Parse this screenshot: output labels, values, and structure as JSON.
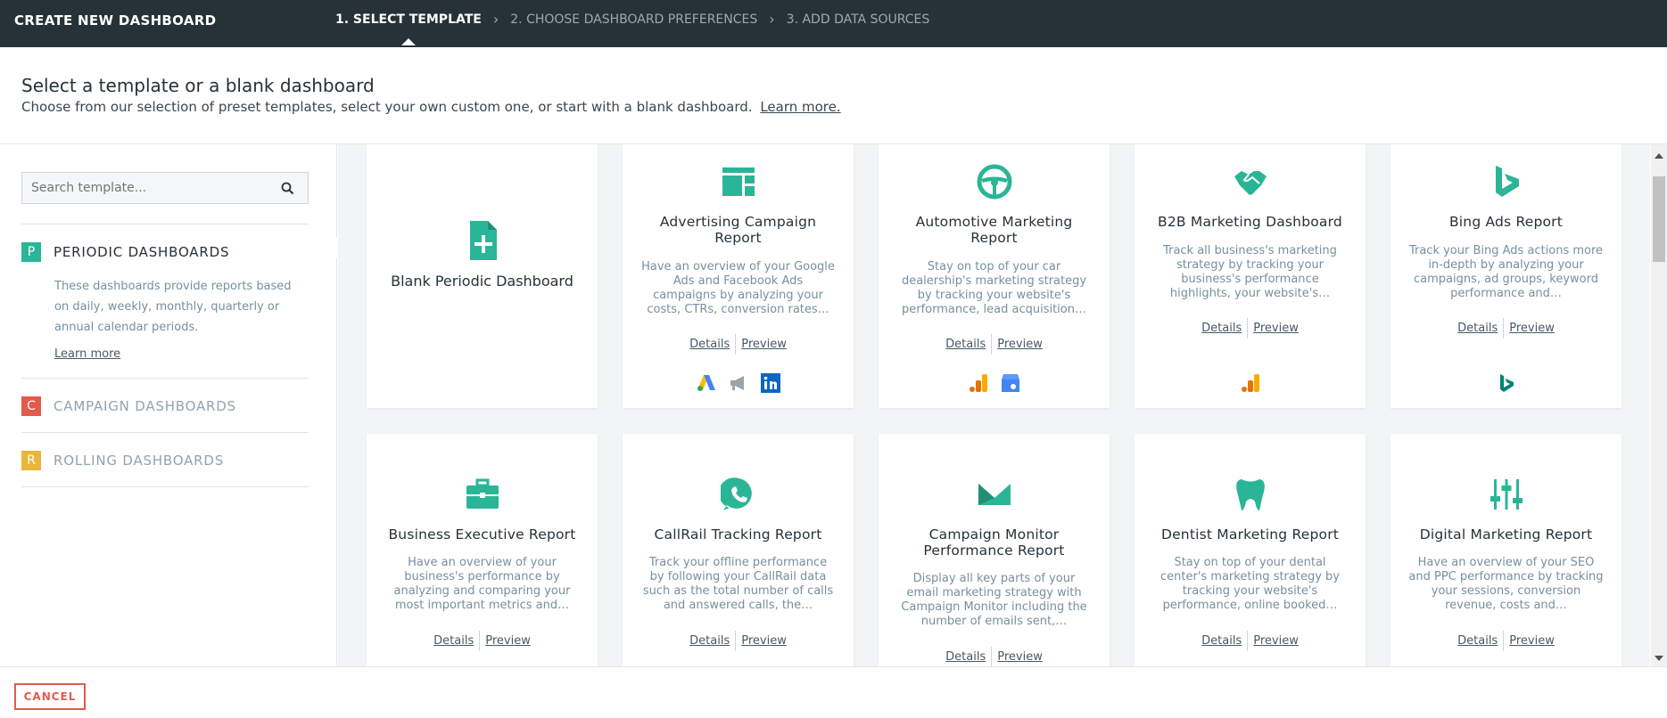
{
  "app_title": "CREATE NEW DASHBOARD",
  "steps": [
    {
      "label": "1. SELECT TEMPLATE"
    },
    {
      "label": "2. CHOOSE DASHBOARD PREFERENCES"
    },
    {
      "label": "3. ADD DATA SOURCES"
    }
  ],
  "header": {
    "title": "Select a template or a blank dashboard",
    "subtitle": "Choose from our selection of preset templates, select your own custom one, or start with a blank dashboard.",
    "learn_more": "Learn more."
  },
  "sidebar": {
    "search_placeholder": "Search template...",
    "categories": [
      {
        "badge": "P",
        "label": "PERIODIC DASHBOARDS",
        "color": "#2bb597",
        "description": "These dashboards provide reports based on daily, weekly, monthly, quarterly or annual calendar periods.",
        "learn_more": "Learn more"
      },
      {
        "badge": "C",
        "label": "CAMPAIGN DASHBOARDS",
        "color": "#e35b4b"
      },
      {
        "badge": "R",
        "label": "ROLLING DASHBOARDS",
        "color": "#e9b63c"
      }
    ]
  },
  "cards": {
    "details_label": "Details",
    "preview_label": "Preview",
    "blank": {
      "title": "Blank Periodic Dashboard"
    },
    "items": [
      {
        "title": "Advertising Campaign Report",
        "desc": "Have an overview of your Google Ads and Facebook Ads campaigns by analyzing your costs, CTRs, conversion rates…"
      },
      {
        "title": "Automotive Marketing Report",
        "desc": "Stay on top of your car dealership's marketing strategy by tracking your website's performance, lead acquisition…"
      },
      {
        "title": "B2B Marketing Dashboard",
        "desc": "Track all business's marketing strategy by tracking your business's performance highlights, your website's…"
      },
      {
        "title": "Bing Ads Report",
        "desc": "Track your Bing Ads actions more in-depth by analyzing your campaigns, ad groups, keyword performance and…"
      },
      {
        "title": "Business Executive Report",
        "desc": "Have an overview of your business's performance by analyzing and comparing your most important metrics and…"
      },
      {
        "title": "CallRail Tracking Report",
        "desc": "Track your offline performance by following your CallRail data such as the total number of calls and answered calls, the…"
      },
      {
        "title": "Campaign Monitor Performance Report",
        "desc": "Display all key parts of your email marketing strategy with Campaign Monitor including the number of emails sent,…"
      },
      {
        "title": "Dentist Marketing Report",
        "desc": "Stay on top of your dental center's marketing strategy by tracking your website's performance, online booked…"
      },
      {
        "title": "Digital Marketing Report",
        "desc": "Have an overview of your SEO and PPC performance by tracking your sessions, conversion revenue, costs and…"
      }
    ]
  },
  "footer": {
    "cancel": "CANCEL"
  },
  "colors": {
    "accent": "#2bb597",
    "topbar": "#263238",
    "cancel": "#e35b4b"
  }
}
